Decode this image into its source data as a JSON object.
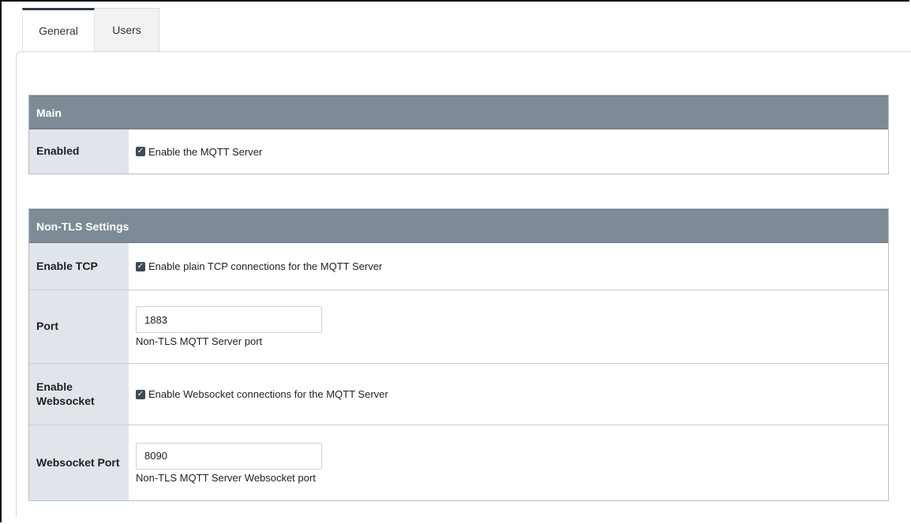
{
  "tabs": [
    {
      "label": "General"
    },
    {
      "label": "Users"
    }
  ],
  "main": {
    "header": "Main",
    "enabled": {
      "label": "Enabled",
      "checkbox_label": "Enable the MQTT Server",
      "checked": true
    }
  },
  "non_tls": {
    "header": "Non-TLS Settings",
    "enable_tcp": {
      "label": "Enable TCP",
      "checkbox_label": "Enable plain TCP connections for the MQTT Server",
      "checked": true
    },
    "port": {
      "label": "Port",
      "value": "1883",
      "hint": "Non-TLS MQTT Server port"
    },
    "enable_websocket": {
      "label_line1": "Enable",
      "label_line2": "Websocket",
      "checkbox_label": "Enable Websocket connections for the MQTT Server",
      "checked": true
    },
    "websocket_port": {
      "label": "Websocket Port",
      "value": "8090",
      "hint": "Non-TLS MQTT Server Websocket port"
    }
  },
  "colors": {
    "section_header_bg": "#7e8b96",
    "label_cell_bg": "#dfe5eb",
    "active_tab_border": "#2b3a4a",
    "checkbox_bg": "#3f4a54"
  },
  "icons": {
    "checkbox": "checkmark-icon"
  }
}
